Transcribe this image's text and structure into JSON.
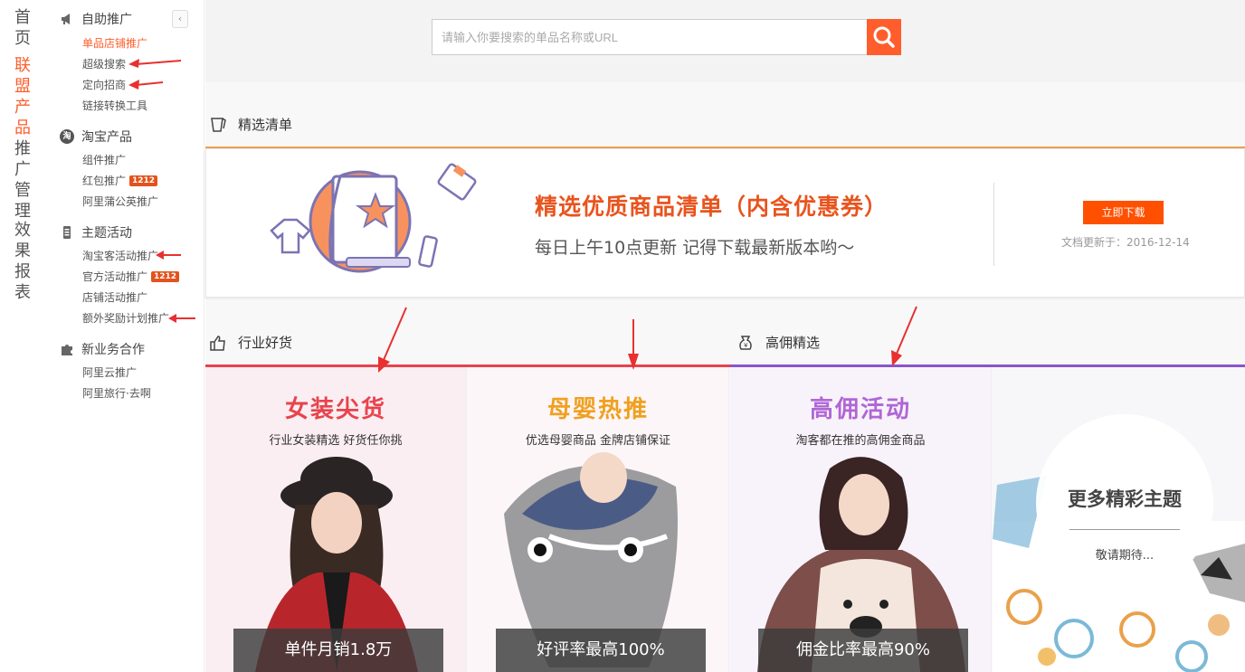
{
  "vertical_nav": [
    {
      "label": "首页",
      "active": false
    },
    {
      "label": "联盟产品",
      "active": true
    },
    {
      "label": "推广管理",
      "active": false
    },
    {
      "label": "效果报表",
      "active": false
    }
  ],
  "sidebar": {
    "collapse_icon": "chevron-left-icon",
    "groups": [
      {
        "title": "自助推广",
        "icon": "megaphone-icon",
        "items": [
          {
            "label": "单品店铺推广",
            "active": true
          },
          {
            "label": "超级搜索"
          },
          {
            "label": "定向招商"
          },
          {
            "label": "链接转换工具"
          }
        ]
      },
      {
        "title": "淘宝产品",
        "icon": "taobao-icon",
        "icon_text": "淘",
        "items": [
          {
            "label": "组件推广"
          },
          {
            "label": "红包推广",
            "badge": "1212"
          },
          {
            "label": "阿里蒲公英推广"
          }
        ]
      },
      {
        "title": "主题活动",
        "icon": "list-icon",
        "items": [
          {
            "label": "淘宝客活动推广"
          },
          {
            "label": "官方活动推广",
            "badge": "1212"
          },
          {
            "label": "店铺活动推广"
          },
          {
            "label": "额外奖励计划推广"
          }
        ]
      },
      {
        "title": "新业务合作",
        "icon": "puzzle-icon",
        "items": [
          {
            "label": "阿里云推广"
          },
          {
            "label": "阿里旅行·去啊"
          }
        ]
      }
    ]
  },
  "search": {
    "placeholder": "请输入你要搜索的单品名称或URL",
    "value": "",
    "button_icon": "search-icon"
  },
  "sections": {
    "featured": {
      "title": "精选清单",
      "icon": "scroll-icon"
    },
    "industry": {
      "title": "行业好货",
      "icon": "thumbs-up-icon"
    },
    "commission": {
      "title": "高佣精选",
      "icon": "money-bag-icon"
    }
  },
  "banner": {
    "title": "精选优质商品清单（内含优惠券）",
    "subtitle": "每日上午10点更新   记得下载最新版本哟～",
    "download_button": "立即下载",
    "update_text": "文档更新于：2016-12-14"
  },
  "cards": [
    {
      "title": "女装尖货",
      "subtitle": "行业女装精选 好货任你挑",
      "footer": "单件月销1.8万",
      "title_color": "#e8434c"
    },
    {
      "title": "母婴热推",
      "subtitle": "优选母婴商品 金牌店铺保证",
      "footer": "好评率最高100%",
      "title_color": "#f0a020"
    },
    {
      "title": "高佣活动",
      "subtitle": "淘客都在推的高佣金商品",
      "footer": "佣金比率最高90%",
      "title_color": "#b066d6"
    }
  ],
  "more": {
    "title": "更多精彩主题",
    "subtitle": "敬请期待..."
  },
  "colors": {
    "accent": "#ff5e2c",
    "red_line": "#e8434c",
    "purple_line": "#8a55c9",
    "orange_line": "#f0a050"
  }
}
